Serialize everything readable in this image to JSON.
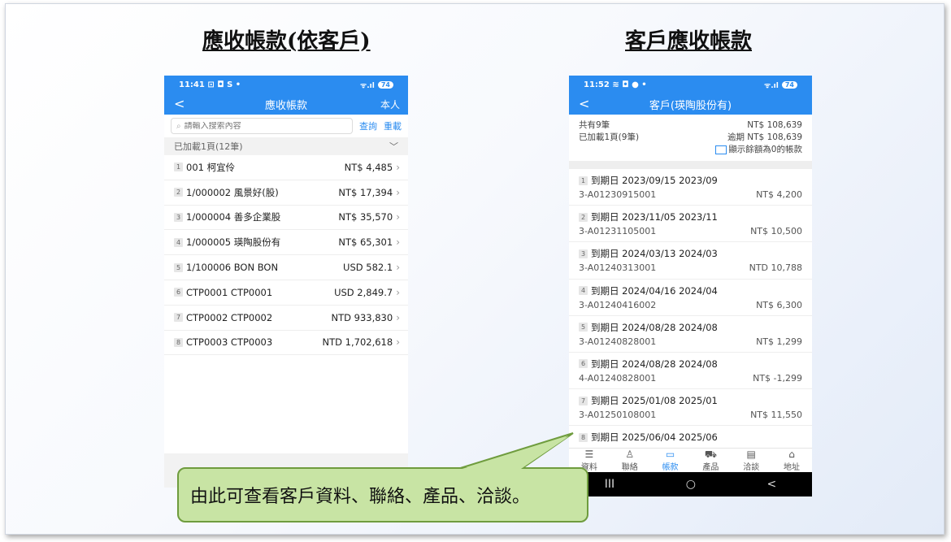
{
  "slide": {
    "left_title": "應收帳款(依客戶)",
    "right_title": "客戶應收帳款",
    "callout": "由此可查看客戶資料、聯絡、產品、洽談。"
  },
  "left_phone": {
    "status": {
      "time": "11:41",
      "icons": "⊡ ◘ S •",
      "battery": "74"
    },
    "nav": {
      "back": "<",
      "title": "應收帳款",
      "right": "本人"
    },
    "search": {
      "placeholder": "請輸入搜索內容",
      "query_label": "查詢",
      "reset_label": "重載"
    },
    "loaded": "已加載1頁(12筆)",
    "rows": [
      {
        "n": "1",
        "name": "001 柯宜伶",
        "amount": "NT$ 4,485"
      },
      {
        "n": "2",
        "name": "1/000002 風景好(股)",
        "amount": "NT$ 17,394"
      },
      {
        "n": "3",
        "name": "1/000004 善多企業股",
        "amount": "NT$ 35,570"
      },
      {
        "n": "4",
        "name": "1/000005 瑛陶股份有",
        "amount": "NT$ 65,301"
      },
      {
        "n": "5",
        "name": "1/100006 BON BON",
        "amount": "USD 582.1"
      },
      {
        "n": "6",
        "name": "CTP0001 CTP0001",
        "amount": "USD 2,849.7"
      },
      {
        "n": "7",
        "name": "CTP0002 CTP0002",
        "amount": "NTD 933,830"
      },
      {
        "n": "8",
        "name": "CTP0003 CTP0003",
        "amount": "NTD 1,702,618"
      }
    ]
  },
  "right_phone": {
    "status": {
      "time": "11:52",
      "icons": "≋ ◘ ● •",
      "battery": "74"
    },
    "nav": {
      "back": "<",
      "title": "客戶(瑛陶股份有)"
    },
    "summary": {
      "total_label": "共有9筆",
      "total_value": "NT$ 108,639",
      "loaded_label": "已加載1頁(9筆)",
      "overdue_value": "逾期 NT$ 108,639",
      "checkbox_label": "顯示餘額為0的帳款"
    },
    "rows": [
      {
        "n": "1",
        "due": "到期日 2023/09/15 2023/09",
        "doc": "3-A01230915001",
        "amount": "NT$ 4,200"
      },
      {
        "n": "2",
        "due": "到期日 2023/11/05 2023/11",
        "doc": "3-A01231105001",
        "amount": "NT$ 10,500"
      },
      {
        "n": "3",
        "due": "到期日 2024/03/13 2024/03",
        "doc": "3-A01240313001",
        "amount": "NTD 10,788"
      },
      {
        "n": "4",
        "due": "到期日 2024/04/16 2024/04",
        "doc": "3-A01240416002",
        "amount": "NT$ 6,300"
      },
      {
        "n": "5",
        "due": "到期日 2024/08/28 2024/08",
        "doc": "3-A01240828001",
        "amount": "NT$ 1,299"
      },
      {
        "n": "6",
        "due": "到期日 2024/08/28 2024/08",
        "doc": "4-A01240828001",
        "amount": "NT$ -1,299"
      },
      {
        "n": "7",
        "due": "到期日 2025/01/08 2025/01",
        "doc": "3-A01250108001",
        "amount": "NT$ 11,550"
      },
      {
        "n": "8",
        "due": "到期日 2025/06/04 2025/06",
        "doc": "",
        "amount": ""
      }
    ],
    "tabs": [
      {
        "icon": "☰",
        "label": "資料",
        "icon_name": "list-icon"
      },
      {
        "icon": "♙",
        "label": "聯絡",
        "icon_name": "person-icon"
      },
      {
        "icon": "▭",
        "label": "帳款",
        "icon_name": "wallet-icon"
      },
      {
        "icon": "⛟",
        "label": "產品",
        "icon_name": "cart-icon"
      },
      {
        "icon": "▤",
        "label": "洽談",
        "icon_name": "chat-icon"
      },
      {
        "icon": "⌂",
        "label": "地址",
        "icon_name": "map-icon"
      }
    ],
    "sysnav": {
      "recent": "III",
      "home": "○",
      "back": "<"
    }
  },
  "colors": {
    "accent": "#2b8cf0",
    "callout_bg": "#c8e4a4",
    "callout_border": "#6f9c3e"
  }
}
